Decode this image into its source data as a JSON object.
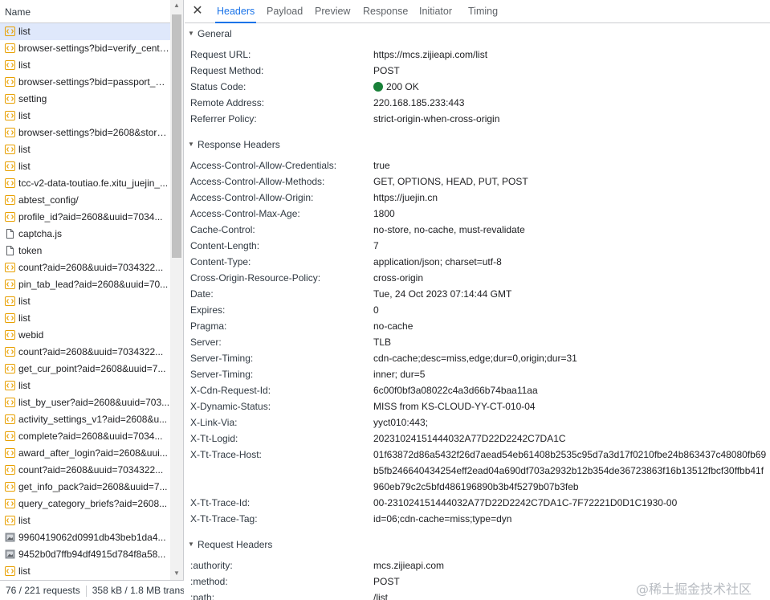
{
  "list": {
    "header": "Name",
    "items": [
      {
        "name": "list",
        "icon": "xhr-icon"
      },
      {
        "name": "browser-settings?bid=verify_center&cid=...",
        "icon": "xhr-icon"
      },
      {
        "name": "list",
        "icon": "xhr-icon"
      },
      {
        "name": "browser-settings?bid=passport_api&...",
        "icon": "xhr-icon"
      },
      {
        "name": "setting",
        "icon": "xhr-icon"
      },
      {
        "name": "list",
        "icon": "xhr-icon"
      },
      {
        "name": "browser-settings?bid=2608&store=...",
        "icon": "xhr-icon"
      },
      {
        "name": "list",
        "icon": "xhr-icon"
      },
      {
        "name": "list",
        "icon": "xhr-icon"
      },
      {
        "name": "tcc-v2-data-toutiao.fe.xitu_juejin_...",
        "icon": "xhr-icon"
      },
      {
        "name": "abtest_config/",
        "icon": "xhr-icon"
      },
      {
        "name": "profile_id?aid=2608&uuid=7034...",
        "icon": "xhr-icon"
      },
      {
        "name": "captcha.js",
        "icon": "document-icon"
      },
      {
        "name": "token",
        "icon": "document-icon"
      },
      {
        "name": "count?aid=2608&uuid=7034322...",
        "icon": "xhr-icon"
      },
      {
        "name": "pin_tab_lead?aid=2608&uuid=70...",
        "icon": "xhr-icon"
      },
      {
        "name": "list",
        "icon": "xhr-icon"
      },
      {
        "name": "list",
        "icon": "xhr-icon"
      },
      {
        "name": "webid",
        "icon": "xhr-icon"
      },
      {
        "name": "count?aid=2608&uuid=7034322...",
        "icon": "xhr-icon"
      },
      {
        "name": "get_cur_point?aid=2608&uuid=7...",
        "icon": "xhr-icon"
      },
      {
        "name": "list",
        "icon": "xhr-icon"
      },
      {
        "name": "list_by_user?aid=2608&uuid=703...",
        "icon": "xhr-icon"
      },
      {
        "name": "activity_settings_v1?aid=2608&u...",
        "icon": "xhr-icon"
      },
      {
        "name": "complete?aid=2608&uuid=7034...",
        "icon": "xhr-icon"
      },
      {
        "name": "award_after_login?aid=2608&uui...",
        "icon": "xhr-icon"
      },
      {
        "name": "count?aid=2608&uuid=7034322...",
        "icon": "xhr-icon"
      },
      {
        "name": "get_info_pack?aid=2608&uuid=7...",
        "icon": "xhr-icon"
      },
      {
        "name": "query_category_briefs?aid=2608...",
        "icon": "xhr-icon"
      },
      {
        "name": "list",
        "icon": "xhr-icon"
      },
      {
        "name": "9960419062d0991db43beb1da4...",
        "icon": "image-icon"
      },
      {
        "name": "9452b0d7ffb94df4915d784f8a58...",
        "icon": "image-icon"
      },
      {
        "name": "list",
        "icon": "xhr-icon"
      }
    ]
  },
  "status_bar": {
    "requests": "76 / 221 requests",
    "transferred": "358 kB / 1.8 MB transferred"
  },
  "tabs": [
    "Headers",
    "Payload",
    "Preview",
    "Response",
    "Initiator",
    "Timing"
  ],
  "active_tab": "Headers",
  "general": {
    "title": "General",
    "rows": [
      {
        "k": "Request URL:",
        "v": "https://mcs.zijieapi.com/list"
      },
      {
        "k": "Request Method:",
        "v": "POST"
      },
      {
        "k": "Status Code:",
        "v": "200 OK"
      },
      {
        "k": "Remote Address:",
        "v": "220.168.185.233:443"
      },
      {
        "k": "Referrer Policy:",
        "v": "strict-origin-when-cross-origin"
      }
    ]
  },
  "response_headers": {
    "title": "Response Headers",
    "rows": [
      {
        "k": "Access-Control-Allow-Credentials:",
        "v": "true"
      },
      {
        "k": "Access-Control-Allow-Methods:",
        "v": "GET, OPTIONS, HEAD, PUT, POST"
      },
      {
        "k": "Access-Control-Allow-Origin:",
        "v": "https://juejin.cn"
      },
      {
        "k": "Access-Control-Max-Age:",
        "v": "1800"
      },
      {
        "k": "Cache-Control:",
        "v": "no-store, no-cache, must-revalidate"
      },
      {
        "k": "Content-Length:",
        "v": "7"
      },
      {
        "k": "Content-Type:",
        "v": "application/json; charset=utf-8"
      },
      {
        "k": "Cross-Origin-Resource-Policy:",
        "v": "cross-origin"
      },
      {
        "k": "Date:",
        "v": "Tue, 24 Oct 2023 07:14:44 GMT"
      },
      {
        "k": "Expires:",
        "v": "0"
      },
      {
        "k": "Pragma:",
        "v": "no-cache"
      },
      {
        "k": "Server:",
        "v": "TLB"
      },
      {
        "k": "Server-Timing:",
        "v": "cdn-cache;desc=miss,edge;dur=0,origin;dur=31"
      },
      {
        "k": "Server-Timing:",
        "v": "inner; dur=5"
      },
      {
        "k": "X-Cdn-Request-Id:",
        "v": "6c00f0bf3a08022c4a3d66b74baa11aa"
      },
      {
        "k": "X-Dynamic-Status:",
        "v": "MISS from KS-CLOUD-YY-CT-010-04"
      },
      {
        "k": "X-Link-Via:",
        "v": "yyct010:443;"
      },
      {
        "k": "X-Tt-Logid:",
        "v": "20231024151444032A77D22D2242C7DA1C"
      },
      {
        "k": "X-Tt-Trace-Host:",
        "v": "01f63872d86a5432f26d7aead54eb61408b2535c95d7a3d17f0210fbe24b863437c48080fb69b5fb246640434254eff2ead04a690df703a2932b12b354de36723863f16b13512fbcf30ffbb41f960eb79c2c5bfd486196890b3b4f5279b07b3feb",
        "lines": 3
      },
      {
        "k": "X-Tt-Trace-Id:",
        "v": "00-231024151444032A77D22D2242C7DA1C-7F72221D0D1C1930-00"
      },
      {
        "k": "X-Tt-Trace-Tag:",
        "v": "id=06;cdn-cache=miss;type=dyn"
      }
    ]
  },
  "request_headers": {
    "title": "Request Headers",
    "rows": [
      {
        "k": ":authority:",
        "v": "mcs.zijieapi.com"
      },
      {
        "k": ":method:",
        "v": "POST"
      },
      {
        "k": ":path:",
        "v": "/list"
      }
    ]
  },
  "colors": {
    "accent": "#1a73e8",
    "selected_row": "#dfe8fb",
    "status_ok": "#188038",
    "xhr_icon": "#e8a000"
  },
  "watermark": "@稀土掘金技术社区"
}
